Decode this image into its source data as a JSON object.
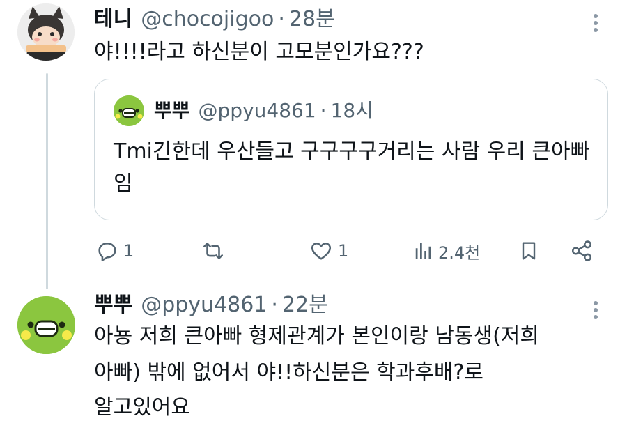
{
  "tweet1": {
    "display_name": "테니",
    "handle": "@chocojigoo",
    "separator": "·",
    "time": "28분",
    "text": "야!!!!라고 하신분이 고모분인가요???",
    "avatar_icon": "cat-avatar-icon"
  },
  "quote": {
    "display_name": "뿌뿌",
    "handle": "@ppyu4861",
    "separator": "·",
    "time": "18시",
    "text": "Tmi긴한데 우산들고 구구구구거리는 사람 우리 큰아빠임",
    "avatar_icon": "green-face-avatar-icon"
  },
  "actions": {
    "reply_count": "1",
    "retweet_count": "",
    "like_count": "1",
    "views_count": "2.4천"
  },
  "tweet2": {
    "display_name": "뿌뿌",
    "handle": "@ppyu4861",
    "separator": "·",
    "time": "22분",
    "line1": "아뇽 저희 큰아빠 형제관계가 본인이랑 남동생(저희",
    "line2": "아빠) 밖에 없어서 야!!하신분은 학과후배?로",
    "line3": "알고있어요",
    "avatar_icon": "green-face-avatar-icon"
  },
  "colors": {
    "text": "#0f1419",
    "secondary": "#536471",
    "border": "#cfd9de",
    "avatar_green": "#8bc63f"
  }
}
